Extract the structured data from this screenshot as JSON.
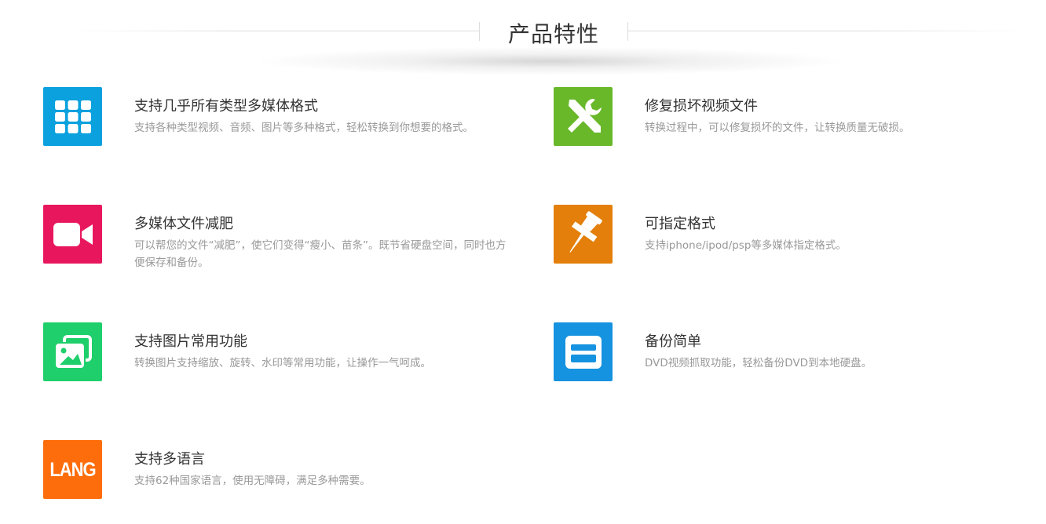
{
  "section": {
    "title": "产品特性"
  },
  "features": [
    {
      "title": "支持几乎所有类型多媒体格式",
      "desc": "支持各种类型视频、音频、图片等多种格式，轻松转换到你想要的格式。",
      "icon": "grid-apps-icon",
      "color": "#0aa1de"
    },
    {
      "title": "修复损坏视频文件",
      "desc": "转换过程中，可以修复损坏的文件，让转换质量无破损。",
      "icon": "tools-icon",
      "color": "#68b82a"
    },
    {
      "title": "多媒体文件减肥",
      "desc": "可以帮您的文件“减肥”，使它们变得“瘦小、苗条”。既节省硬盘空间，同时也方便保存和备份。",
      "icon": "video-camera-icon",
      "color": "#e8175d"
    },
    {
      "title": "可指定格式",
      "desc": "支持iphone/ipod/psp等多媒体指定格式。",
      "icon": "pushpin-icon",
      "color": "#e37f0a"
    },
    {
      "title": "支持图片常用功能",
      "desc": "转换图片支持缩放、旋转、水印等常用功能，让操作一气呵成。",
      "icon": "pictures-icon",
      "color": "#1ecf6b"
    },
    {
      "title": "备份简单",
      "desc": "DVD视频抓取功能，轻松备份DVD到本地硬盘。",
      "icon": "floppy-disk-icon",
      "color": "#1592e0"
    },
    {
      "title": "支持多语言",
      "desc": "支持62种国家语言，使用无障碍，满足多种需要。",
      "icon": "lang-icon",
      "icon_text": "LANG",
      "color": "#fe6d0b"
    }
  ]
}
